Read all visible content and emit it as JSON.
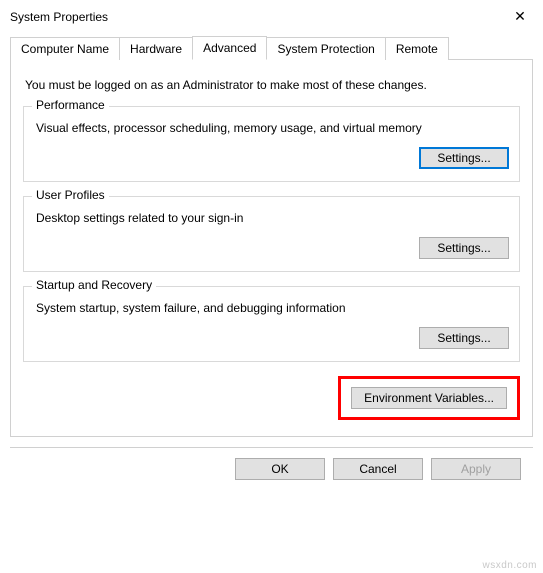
{
  "window": {
    "title": "System Properties",
    "close_glyph": "✕"
  },
  "tabs": {
    "computer_name": "Computer Name",
    "hardware": "Hardware",
    "advanced": "Advanced",
    "system_protection": "System Protection",
    "remote": "Remote"
  },
  "advanced_panel": {
    "intro": "You must be logged on as an Administrator to make most of these changes.",
    "performance": {
      "legend": "Performance",
      "desc": "Visual effects, processor scheduling, memory usage, and virtual memory",
      "settings_label": "Settings..."
    },
    "user_profiles": {
      "legend": "User Profiles",
      "desc": "Desktop settings related to your sign-in",
      "settings_label": "Settings..."
    },
    "startup_recovery": {
      "legend": "Startup and Recovery",
      "desc": "System startup, system failure, and debugging information",
      "settings_label": "Settings..."
    },
    "env_button": "Environment Variables..."
  },
  "buttons": {
    "ok": "OK",
    "cancel": "Cancel",
    "apply": "Apply"
  },
  "watermark": "wsxdn.com"
}
